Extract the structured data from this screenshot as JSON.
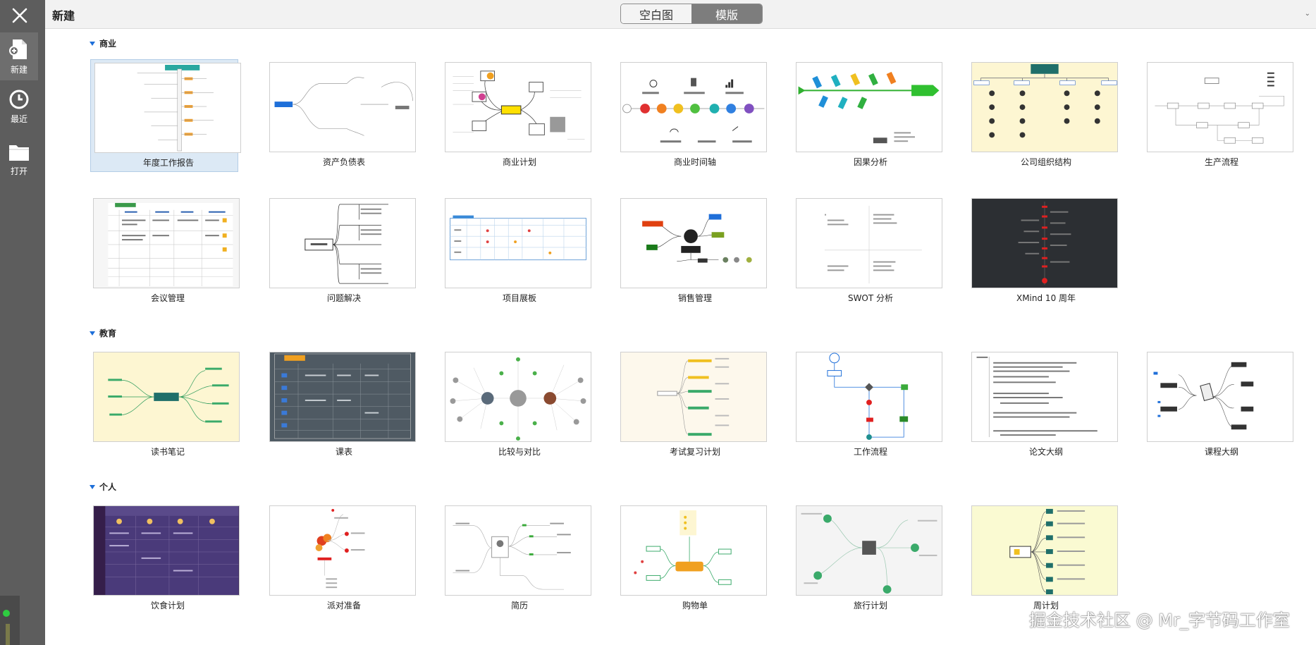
{
  "app": {
    "title": "新建",
    "segment": {
      "blank": "空白图",
      "template": "模版",
      "active": "template"
    },
    "corner_mark": "⌄"
  },
  "sidebar": {
    "close_icon": "close-icon",
    "items": [
      {
        "label": "新建",
        "icon": "new-file-icon",
        "active": true
      },
      {
        "label": "最近",
        "icon": "clock-icon",
        "active": false
      },
      {
        "label": "打开",
        "icon": "folder-icon",
        "active": false
      }
    ]
  },
  "sections": [
    {
      "title": "商业",
      "templates": [
        "年度工作报告",
        "资产负债表",
        "商业计划",
        "商业时间轴",
        "因果分析",
        "公司组织结构",
        "生产流程",
        "会议管理",
        "问题解决",
        "项目展板",
        "销售管理",
        "SWOT 分析",
        "XMind 10 周年"
      ]
    },
    {
      "title": "教育",
      "templates": [
        "读书笔记",
        "课表",
        "比较与对比",
        "考试复习计划",
        "工作流程",
        "论文大纲",
        "课程大纲"
      ]
    },
    {
      "title": "个人",
      "templates": [
        "饮食计划",
        "派对准备",
        "简历",
        "购物单",
        "旅行计划",
        "周计划"
      ]
    }
  ],
  "watermark": "掘金技术社区 @ Mr_字节码工作室",
  "colors": {
    "sidebar": "#5d5d5d",
    "accent": "#1e6fd9",
    "selected": "#dce9f5",
    "segment_active": "#7d7d7d"
  }
}
